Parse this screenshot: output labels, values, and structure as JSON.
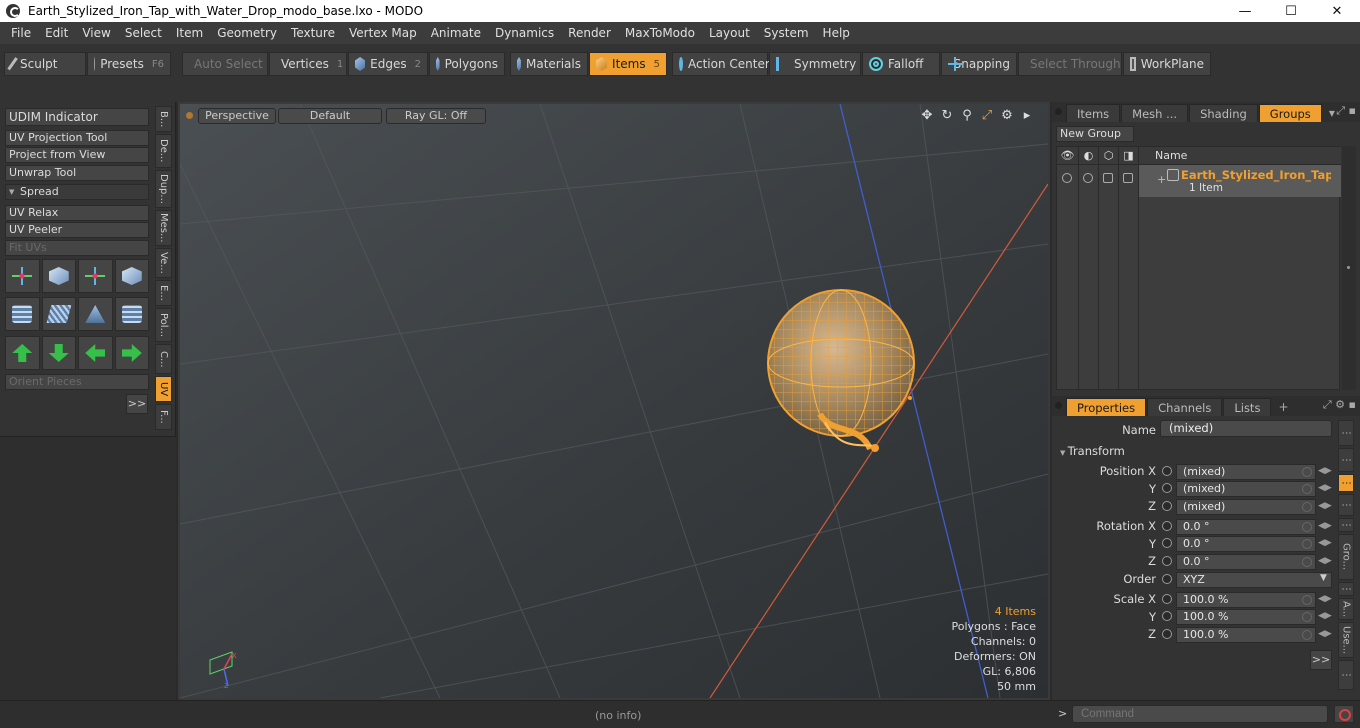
{
  "window": {
    "title": "Earth_Stylized_Iron_Tap_with_Water_Drop_modo_base.lxo - MODO",
    "minimize": "—",
    "maximize": "☐",
    "close": "✕"
  },
  "menu": [
    "File",
    "Edit",
    "View",
    "Select",
    "Item",
    "Geometry",
    "Texture",
    "Vertex Map",
    "Animate",
    "Dynamics",
    "Render",
    "MaxToModo",
    "Layout",
    "System",
    "Help"
  ],
  "toolbar": {
    "sculpt": "Sculpt",
    "presets": "Presets",
    "presets_key": "F6",
    "auto_select": "Auto Select",
    "vertices": "Vertices",
    "vertices_key": "1",
    "edges": "Edges",
    "edges_key": "2",
    "polygons": "Polygons",
    "materials": "Materials",
    "items": "Items",
    "items_key": "5",
    "action_center": "Action Center",
    "symmetry": "Symmetry",
    "falloff": "Falloff",
    "snapping": "Snapping",
    "select_through": "Select Through",
    "workplane": "WorkPlane"
  },
  "left_panel": {
    "buttons": [
      "UDIM Indicator",
      "UV Projection Tool",
      "Project from View",
      "Unwrap Tool"
    ],
    "section": "Spread",
    "buttons2": [
      "UV Relax",
      "UV Peeler"
    ],
    "fit_uvs": "Fit UVs",
    "orient_pieces": "Orient Pieces",
    "more": ">>",
    "vtabs": [
      "B...",
      "De...",
      "Dup...",
      "Mes...",
      "Ve...",
      "E...",
      "Pol...",
      "C...",
      "UV",
      "F..."
    ]
  },
  "viewport": {
    "perspective": "Perspective",
    "default": "Default",
    "raygl": "Ray GL: Off",
    "stats": {
      "items": "4 Items",
      "polygons": "Polygons : Face",
      "channels": "Channels: 0",
      "deformers": "Deformers: ON",
      "gl": "GL: 6,806",
      "lens": "50 mm"
    }
  },
  "groups_panel": {
    "tabs": [
      "Items",
      "Mesh ...",
      "Shading",
      "Groups"
    ],
    "active_tab": "Groups",
    "new_group": "New Group",
    "col_name": "Name",
    "row_name": "Earth_Stylized_Iron_Tap ...",
    "row_sub": "1 Item",
    "plus": "+"
  },
  "properties": {
    "tabs": [
      "Properties",
      "Channels",
      "Lists"
    ],
    "name_label": "Name",
    "name_value": "(mixed)",
    "section": "Transform",
    "position_x_label": "Position X",
    "y_label": "Y",
    "z_label": "Z",
    "position": [
      "(mixed)",
      "(mixed)",
      "(mixed)"
    ],
    "rotation_x_label": "Rotation X",
    "rotation": [
      "0.0 °",
      "0.0 °",
      "0.0 °"
    ],
    "order_label": "Order",
    "order_value": "XYZ",
    "scale_x_label": "Scale X",
    "scale": [
      "100.0 %",
      "100.0 %",
      "100.0 %"
    ],
    "more": ">>",
    "side_tabs": [
      "Gro...",
      "A...",
      "Use..."
    ]
  },
  "status": {
    "info": "(no info)",
    "prompt": ">",
    "command_placeholder": "Command"
  },
  "colors": {
    "accent": "#f0a030",
    "background": "#2b2b2b",
    "viewport": "#2f2f2f"
  }
}
